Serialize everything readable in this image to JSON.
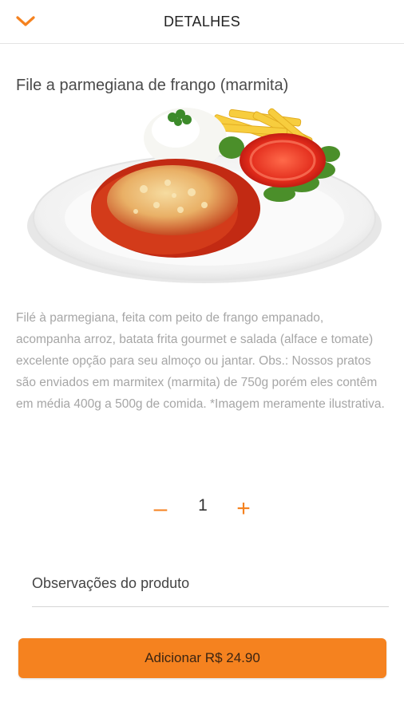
{
  "header": {
    "title": "DETALHES",
    "back_icon": "chevron-down-icon",
    "accent_color": "#f5821f"
  },
  "product": {
    "title": "File a parmegiana de frango (marmita)",
    "description": "Filé à parmegiana, feita com peito de frango empanado, acompanha arroz, batata frita gourmet e salada (alface e tomate) excelente opção para seu almoço ou jantar. Obs.: Nossos pratos são enviados em marmitex (marmita) de 750g porém eles contêm em média 400g a 500g de comida. *Imagem meramente ilustrativa."
  },
  "quantity": {
    "minus": "–",
    "value": "1",
    "plus": "+"
  },
  "observations": {
    "label": "Observações do produto"
  },
  "add_button": {
    "label": "Adicionar R$ 24.90"
  }
}
